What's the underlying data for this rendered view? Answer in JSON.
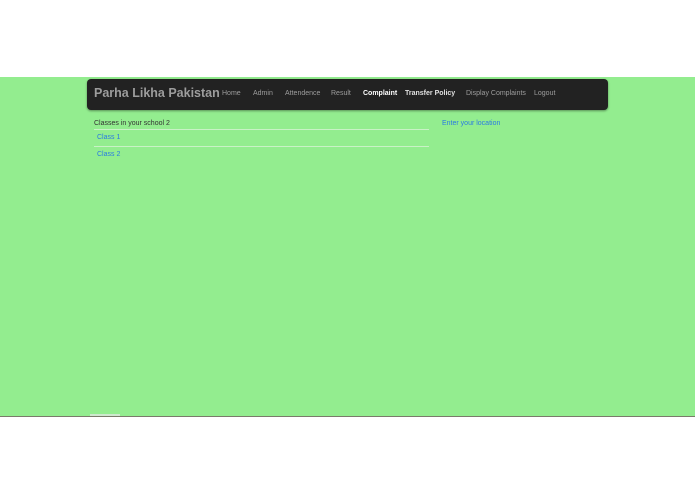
{
  "navbar": {
    "brand": "Parha Likha Pakistan",
    "items": [
      {
        "label": "Home"
      },
      {
        "label": "Admin"
      },
      {
        "label": "Attendence"
      },
      {
        "label": "Result"
      },
      {
        "label": "Complaint"
      },
      {
        "label": "Transfer Policy"
      },
      {
        "label": "Display Complaints"
      },
      {
        "label": "Logout"
      }
    ]
  },
  "main": {
    "title": "Classes in your school 2",
    "classes": [
      {
        "label": "Class 1"
      },
      {
        "label": "Class 2"
      }
    ]
  },
  "sidebar": {
    "location_link": "Enter your location"
  },
  "colors": {
    "page_background": "#93ed8f",
    "navbar_background": "#222222",
    "link": "#2a7ae2"
  }
}
